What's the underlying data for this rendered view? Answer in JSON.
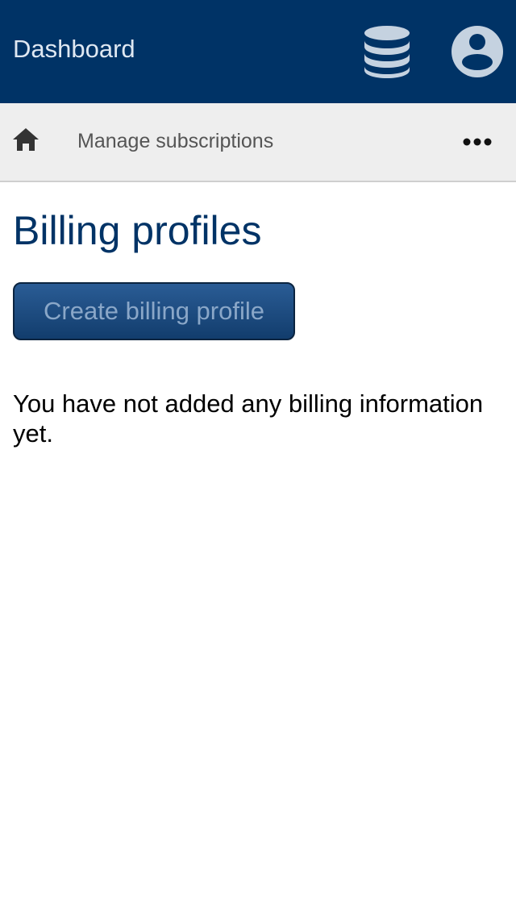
{
  "header": {
    "title": "Dashboard",
    "background_color": "#003366",
    "icons": [
      "database-icon",
      "account-icon"
    ]
  },
  "subnav": {
    "home_icon": "home-icon",
    "link_label": "Manage subscriptions",
    "more_icon": "more-horizontal-icon"
  },
  "main": {
    "title": "Billing profiles",
    "create_button_label": "Create billing profile",
    "empty_message": "You have not added any billing information yet.",
    "accent_color": "#003366"
  }
}
